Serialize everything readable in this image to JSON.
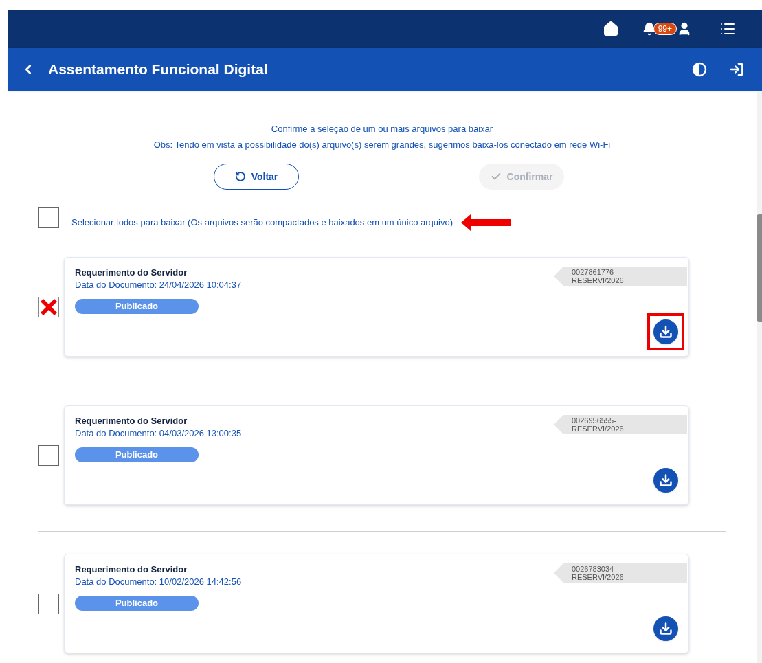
{
  "topbar": {
    "badge": "99+"
  },
  "header": {
    "title": "Assentamento Funcional Digital"
  },
  "notice": {
    "line1": "Confirme a seleção de um ou mais arquivos para baixar",
    "line2": "Obs: Tendo em vista a possibilidade do(s) arquivo(s) serem grandes, sugerimos baixá-los conectado em rede Wi-Fi"
  },
  "buttons": [
    {
      "label": "Voltar",
      "kind": "back",
      "disabled": false
    },
    {
      "label": "Confirmar",
      "kind": "confirm",
      "disabled": true
    }
  ],
  "select_all": {
    "label": "Selecionar todos para baixar (Os arquivos serão compactados e baixados em um único arquivo)",
    "checked": false,
    "arrow": true
  },
  "documents": [
    {
      "title": "Requerimento do Servidor",
      "date": "Data do Documento: 24/04/2026 10:04:37",
      "status": "Publicado",
      "code": "0027861776-\nRESERVI/2026",
      "checked": true,
      "highlighted": true
    },
    {
      "title": "Requerimento do Servidor",
      "date": "Data do Documento: 04/03/2026 13:00:35",
      "status": "Publicado",
      "code": "0026956555-\nRESERVI/2026",
      "checked": false,
      "highlighted": false
    },
    {
      "title": "Requerimento do Servidor",
      "date": "Data do Documento: 10/02/2026 14:42:56",
      "status": "Publicado",
      "code": "0026783034-\nRESERVI/2026",
      "checked": false,
      "highlighted": false
    }
  ]
}
